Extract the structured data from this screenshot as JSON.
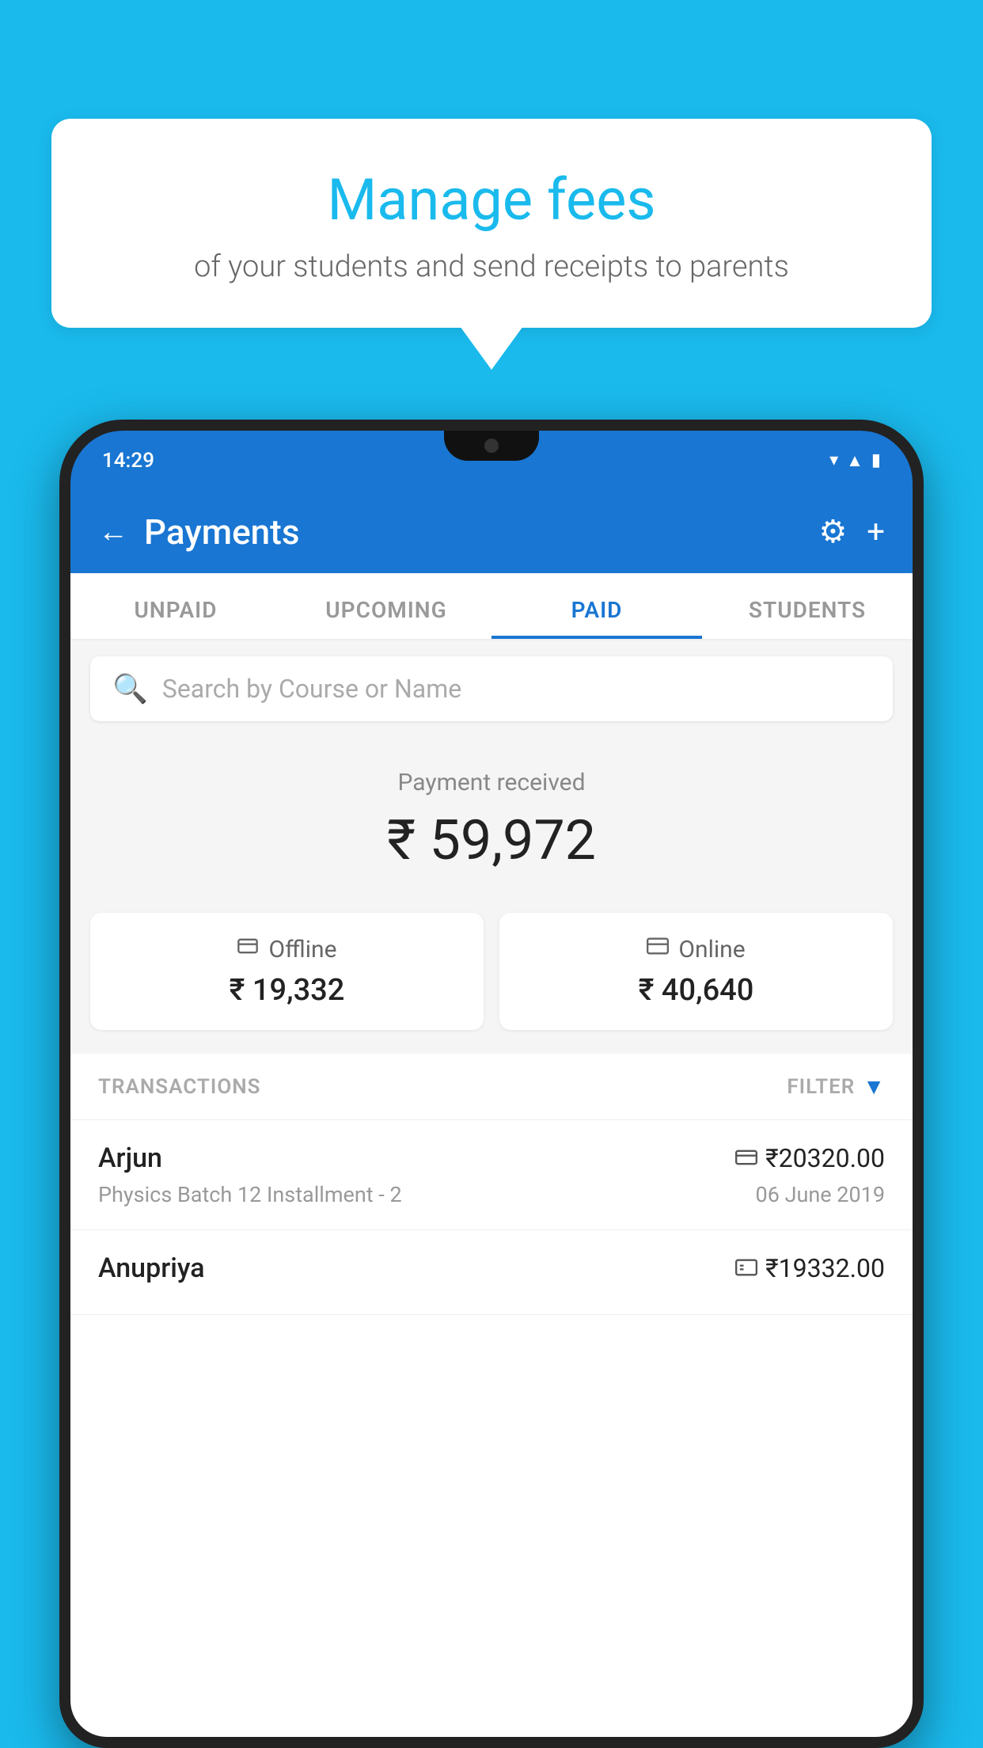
{
  "background_color": "#1ABAED",
  "speech_bubble": {
    "title": "Manage fees",
    "subtitle": "of your students and send receipts to parents"
  },
  "phone": {
    "status_bar": {
      "time": "14:29",
      "icons": [
        "wifi",
        "signal",
        "battery"
      ]
    },
    "header": {
      "back_label": "←",
      "title": "Payments",
      "settings_icon": "⚙",
      "add_icon": "+"
    },
    "tabs": [
      {
        "label": "UNPAID",
        "active": false
      },
      {
        "label": "UPCOMING",
        "active": false
      },
      {
        "label": "PAID",
        "active": true
      },
      {
        "label": "STUDENTS",
        "active": false
      }
    ],
    "search": {
      "placeholder": "Search by Course or Name"
    },
    "payment_received": {
      "label": "Payment received",
      "amount": "₹ 59,972"
    },
    "payment_breakdown": {
      "offline": {
        "icon": "💳",
        "label": "Offline",
        "amount": "₹ 19,332"
      },
      "online": {
        "icon": "💳",
        "label": "Online",
        "amount": "₹ 40,640"
      }
    },
    "transactions": {
      "header_label": "TRANSACTIONS",
      "filter_label": "FILTER",
      "items": [
        {
          "name": "Arjun",
          "detail": "Physics Batch 12 Installment - 2",
          "amount": "₹20320.00",
          "date": "06 June 2019",
          "payment_type": "online"
        },
        {
          "name": "Anupriya",
          "detail": "",
          "amount": "₹19332.00",
          "date": "",
          "payment_type": "offline"
        }
      ]
    }
  }
}
